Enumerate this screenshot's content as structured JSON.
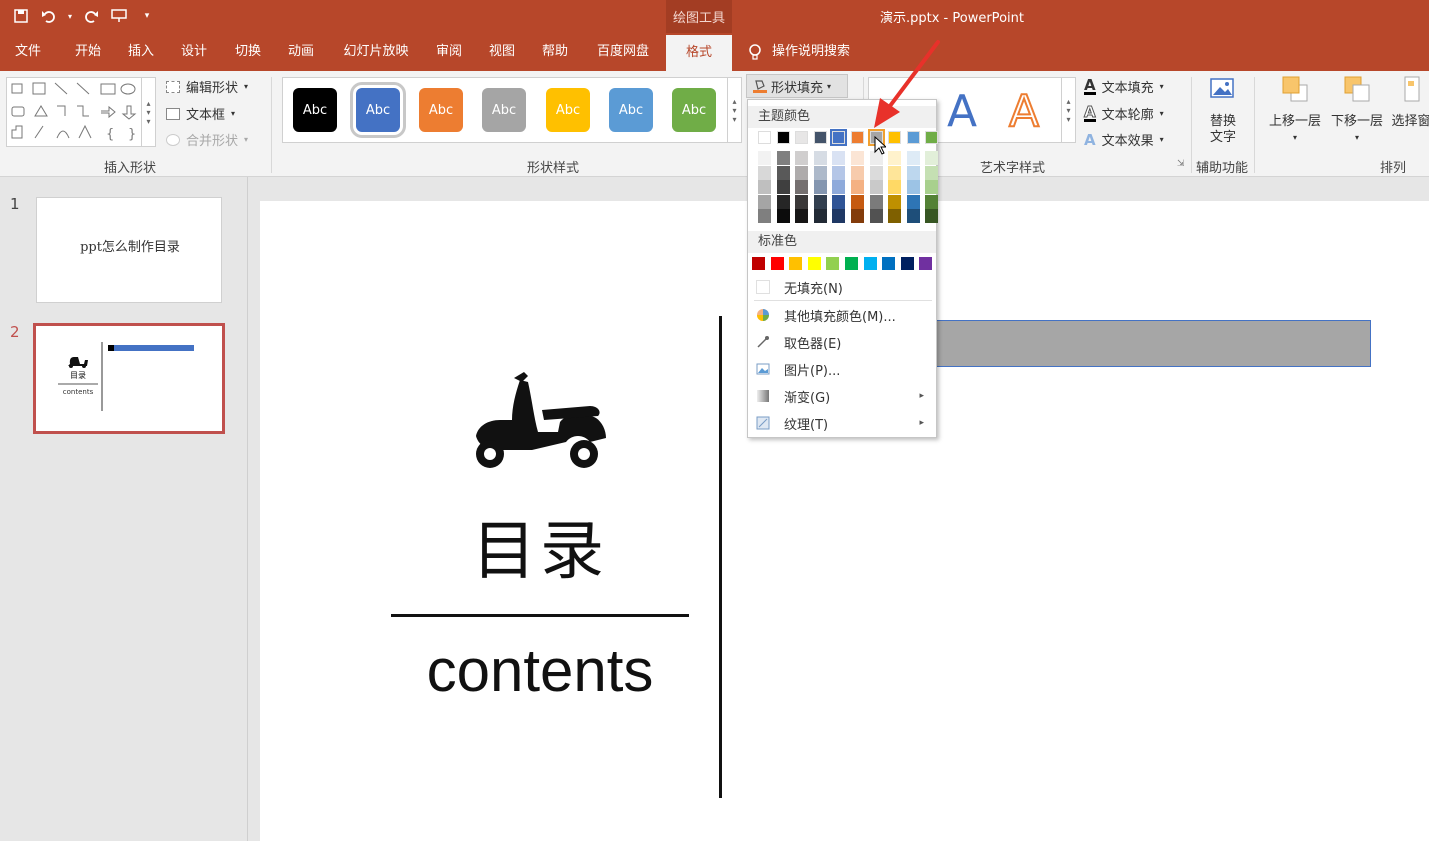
{
  "titlebar": {
    "context_group": "绘图工具",
    "doc_title": "演示.pptx  -  PowerPoint",
    "qat_icons": [
      "save-icon",
      "undo-icon",
      "redo-icon",
      "start-from-beginning-icon",
      "customize-qat-icon"
    ]
  },
  "tabs": [
    "文件",
    "开始",
    "插入",
    "设计",
    "切换",
    "动画",
    "幻灯片放映",
    "审阅",
    "视图",
    "帮助",
    "百度网盘",
    "格式"
  ],
  "active_tab": "格式",
  "tell_me": "操作说明搜索",
  "ribbon": {
    "insert_shapes": {
      "label": "插入形状",
      "edit_shape": "编辑形状",
      "text_box": "文本框",
      "merge_shapes": "合并形状"
    },
    "shape_styles": {
      "label": "形状样式",
      "swatch_text": "Abc",
      "swatches": [
        "#000000",
        "#4472c4",
        "#ed7d31",
        "#a5a5a5",
        "#ffc000",
        "#5b9bd5",
        "#70ad47"
      ],
      "shape_fill": "形状填充"
    },
    "wordart": {
      "label": "艺术字样式",
      "letter": "A",
      "text_fill": "文本填充",
      "text_outline": "文本轮廓",
      "text_effects": "文本效果"
    },
    "accessibility": {
      "label": "辅助功能",
      "alt_text": "替换\n文字"
    },
    "arrange": {
      "label": "排列",
      "bring_forward": "上移一层",
      "send_backward": "下移一层",
      "selection_pane": "选择窗"
    }
  },
  "slides_pane": {
    "slides": [
      {
        "number": "1",
        "text": "ppt怎么制作目录"
      },
      {
        "number": "2",
        "text_cn": "目录",
        "text_en": "contents"
      }
    ]
  },
  "slide": {
    "title_cn": "目录",
    "title_en": "contents"
  },
  "fill_menu": {
    "theme_colors_label": "主题颜色",
    "theme_top": [
      "#ffffff",
      "#000000",
      "#e7e6e6",
      "#44546a",
      "#4472c4",
      "#ed7d31",
      "#a5a5a5",
      "#ffc000",
      "#5b9bd5",
      "#70ad47"
    ],
    "theme_shades": [
      [
        "#f2f2f2",
        "#7f7f7f",
        "#d0cece",
        "#d6dce4",
        "#d9e2f3",
        "#fbe5d5",
        "#ededed",
        "#fff2cc",
        "#deebf6",
        "#e2efd9"
      ],
      [
        "#d8d8d8",
        "#595959",
        "#aeabab",
        "#adb9ca",
        "#b4c6e7",
        "#f7cbac",
        "#dbdbdb",
        "#fee599",
        "#bdd7ee",
        "#c5e0b3"
      ],
      [
        "#bfbfbf",
        "#3f3f3f",
        "#757070",
        "#8496b0",
        "#8eaadb",
        "#f4b183",
        "#c9c9c9",
        "#ffd965",
        "#9cc3e5",
        "#a8d08d"
      ],
      [
        "#a5a5a5",
        "#262626",
        "#3a3838",
        "#323f4f",
        "#2f5496",
        "#c55a11",
        "#7b7b7b",
        "#bf9000",
        "#2e75b5",
        "#538135"
      ],
      [
        "#7f7f7f",
        "#0c0c0c",
        "#171616",
        "#222a35",
        "#1f3864",
        "#833c0b",
        "#525252",
        "#7f6000",
        "#1e4e79",
        "#375623"
      ]
    ],
    "standard_colors_label": "标准色",
    "standard_colors": [
      "#c00000",
      "#ff0000",
      "#ffc000",
      "#ffff00",
      "#92d050",
      "#00b050",
      "#00b0f0",
      "#0070c0",
      "#002060",
      "#7030a0"
    ],
    "no_fill": "无填充(N)",
    "more_colors": "其他填充颜色(M)...",
    "eyedropper": "取色器(E)",
    "picture": "图片(P)...",
    "gradient": "渐变(G)",
    "texture": "纹理(T)"
  },
  "colors": {
    "accent": "#b7472a",
    "annotation_arrow": "#e8312a"
  }
}
